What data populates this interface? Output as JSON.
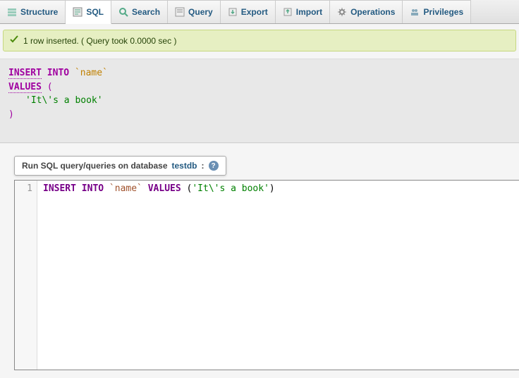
{
  "tabs": {
    "structure": "Structure",
    "sql": "SQL",
    "search": "Search",
    "query": "Query",
    "export": "Export",
    "import": "Import",
    "operations": "Operations",
    "privileges": "Privileges"
  },
  "success": {
    "message": "1 row inserted. ( Query took 0.0000 sec )"
  },
  "executed_query": {
    "insert": "INSERT",
    "into": "INTO",
    "table": "`name`",
    "values_kw": "VALUES",
    "open_paren": "(",
    "string_value": "'It\\'s a book'",
    "close_paren": ")"
  },
  "run_header": {
    "prefix": "Run SQL query/queries on database",
    "dbname": "testdb",
    "colon": ":"
  },
  "editor": {
    "line_number": "1",
    "tokens": {
      "insert_into": "INSERT INTO",
      "table": "`name`",
      "values": "VALUES",
      "open": "(",
      "str": "'It\\'s a book'",
      "close": ")"
    }
  }
}
